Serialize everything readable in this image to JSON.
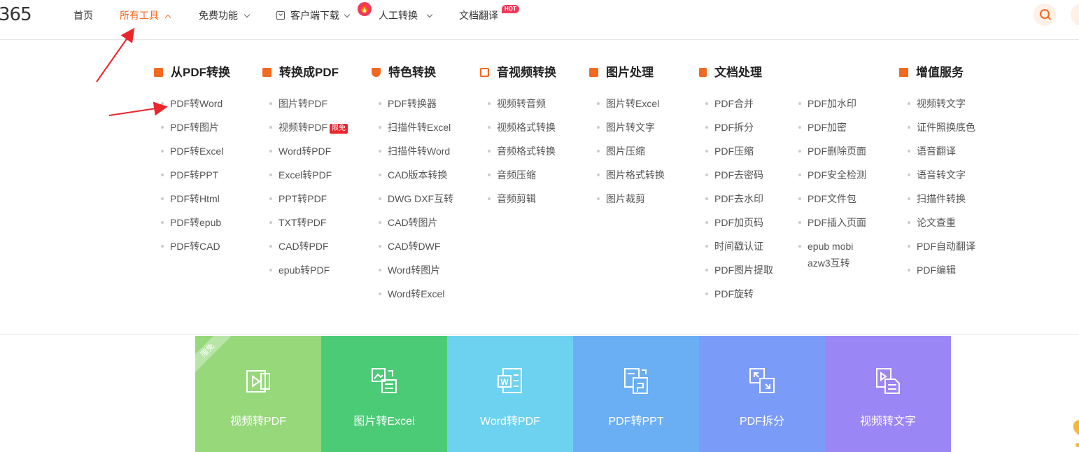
{
  "logo": "365",
  "nav": {
    "home": "首页",
    "all_tools": "所有工具",
    "free": "免费功能",
    "download": "客户端下载",
    "manual": "人工转换",
    "translate": "文档翻译",
    "hot_badge": "HOT"
  },
  "columns": [
    {
      "title": "从PDF转换",
      "items": [
        "PDF转Word",
        "PDF转图片",
        "PDF转Excel",
        "PDF转PPT",
        "PDF转Html",
        "PDF转epub",
        "PDF转CAD"
      ]
    },
    {
      "title": "转换成PDF",
      "items": [
        "图片转PDF",
        "视频转PDF",
        "Word转PDF",
        "Excel转PDF",
        "PPT转PDF",
        "TXT转PDF",
        "CAD转PDF",
        "epub转PDF"
      ],
      "free_tag": "限免"
    },
    {
      "title": "特色转换",
      "items": [
        "PDF转换器",
        "扫描件转Excel",
        "扫描件转Word",
        "CAD版本转换",
        "DWG DXF互转",
        "CAD转图片",
        "CAD转DWF",
        "Word转图片",
        "Word转Excel"
      ]
    },
    {
      "title": "音视频转换",
      "items": [
        "视频转音频",
        "视频格式转换",
        "音频格式转换",
        "音频压缩",
        "音频剪辑"
      ]
    },
    {
      "title": "图片处理",
      "items": [
        "图片转Excel",
        "图片转文字",
        "图片压缩",
        "图片格式转换",
        "图片裁剪"
      ]
    },
    {
      "title": "文档处理",
      "items": [
        "PDF合并",
        "PDF拆分",
        "PDF压缩",
        "PDF去密码",
        "PDF去水印",
        "PDF加页码",
        "时间戳认证",
        "PDF图片提取",
        "PDF旋转"
      ]
    },
    {
      "title": "",
      "items": [
        "PDF加水印",
        "PDF加密",
        "PDF删除页面",
        "PDF安全检测",
        "PDF文件包",
        "PDF插入页面",
        "epub mobi azw3互转"
      ]
    },
    {
      "title": "增值服务",
      "items": [
        "视频转文字",
        "证件照换底色",
        "语音翻译",
        "语音转文字",
        "扫描件转换",
        "论文查重",
        "PDF自动翻译",
        "PDF编辑"
      ]
    }
  ],
  "tiles": [
    {
      "label": "视频转PDF",
      "color": "#96d87a",
      "ribbon": "限免"
    },
    {
      "label": "图片转Excel",
      "color": "#4ccb77",
      "ribbon": ""
    },
    {
      "label": "Word转PDF",
      "color": "#6dd2ef",
      "ribbon": ""
    },
    {
      "label": "PDF转PPT",
      "color": "#6aaef3",
      "ribbon": ""
    },
    {
      "label": "PDF拆分",
      "color": "#7b9bf8",
      "ribbon": ""
    },
    {
      "label": "视频转文字",
      "color": "#9a86f5",
      "ribbon": ""
    }
  ],
  "accent_color": "#f26a21"
}
